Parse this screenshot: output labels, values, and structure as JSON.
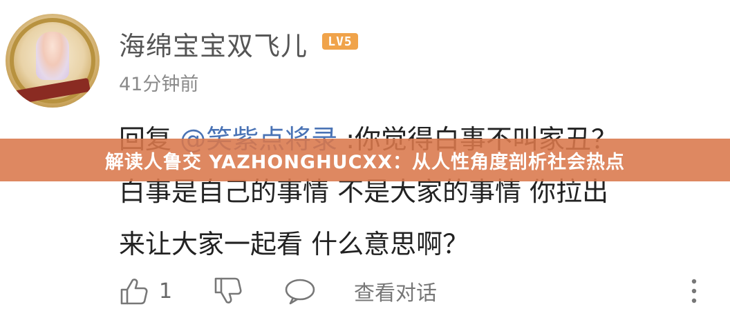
{
  "comment": {
    "username": "海绵宝宝双飞儿",
    "level": "LV5",
    "time": "41分钟前",
    "reply_prefix": "回复 ",
    "mention": "@笑紫点将录",
    "line1_rest": " :你觉得白事不叫家丑？",
    "line2": "白事是自己的事情 不是大家的事情 你拉出",
    "line3": "来让大家一起看 什么意思啊？"
  },
  "overlay": {
    "title": "解读人鲁交 YAZHONGHUCXX：从人性角度剖析社会热点"
  },
  "actions": {
    "like_count": "1",
    "view_replies": "查看对话"
  },
  "colors": {
    "accent": "#f0a34a",
    "mention": "#4a73b5",
    "overlay": "#da784b"
  },
  "icons": [
    "thumbs-up-icon",
    "thumbs-down-icon",
    "comment-bubble-icon",
    "more-vertical-icon"
  ]
}
